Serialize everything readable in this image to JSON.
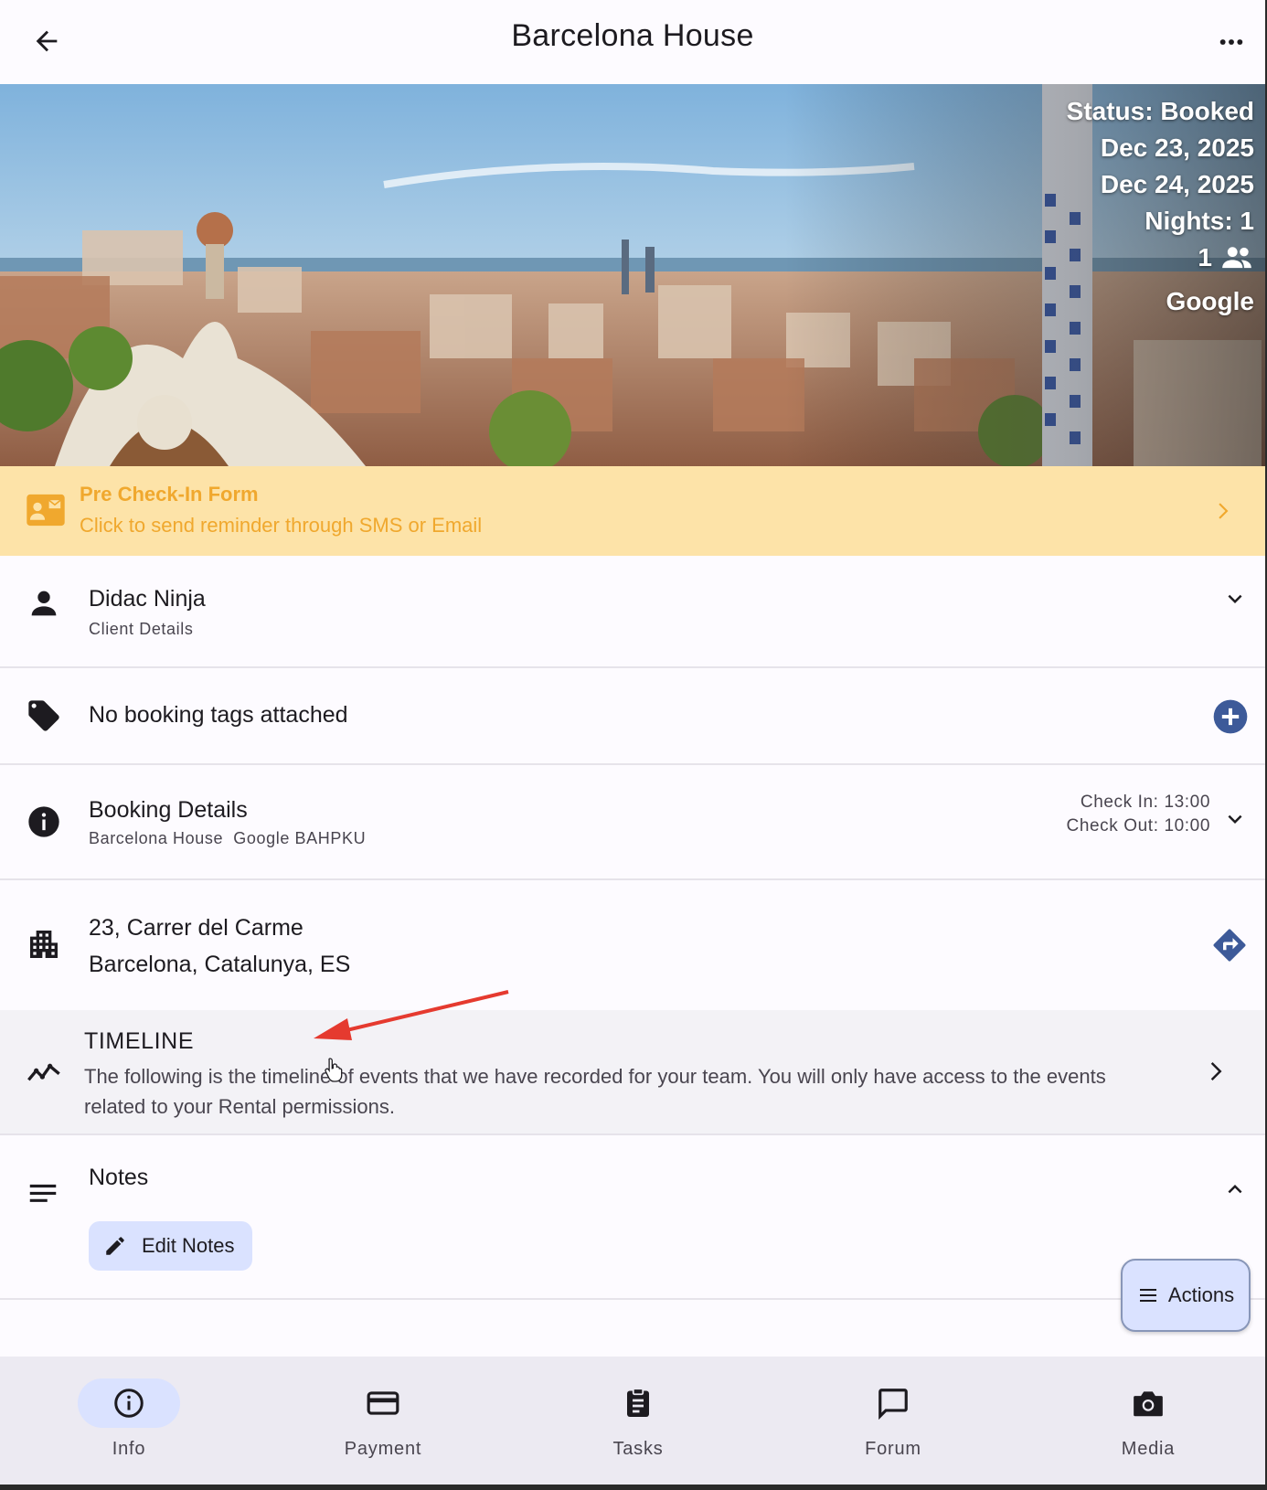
{
  "header": {
    "title": "Barcelona House",
    "back_icon": "arrow-back-icon",
    "more_icon": "more-horiz-icon"
  },
  "hero": {
    "status": "Status: Booked",
    "check_in_date": "Dec 23, 2025",
    "check_out_date": "Dec 24, 2025",
    "nights": "Nights: 1",
    "guests": "1",
    "source": "Google"
  },
  "banner": {
    "title": "Pre Check-In Form",
    "subtitle": "Click to send reminder through SMS or Email",
    "color": "#f0a82e",
    "background": "#fde3a8"
  },
  "client": {
    "name": "Didac Ninja",
    "label": "Client Details"
  },
  "tags": {
    "text": "No booking tags attached"
  },
  "booking": {
    "title": "Booking Details",
    "property": "Barcelona House",
    "source_code": "Google BAHPKU",
    "check_in": "Check In: 13:00",
    "check_out": "Check Out: 10:00"
  },
  "address": {
    "line1": "23, Carrer del Carme",
    "line2": "Barcelona, Catalunya, ES"
  },
  "timeline": {
    "title": "TIMELINE",
    "description": "The following is the timeline of events that we have recorded for your team. You will only have access to the events related to your Rental permissions."
  },
  "notes": {
    "title": "Notes",
    "edit_label": "Edit Notes"
  },
  "actions": {
    "label": "Actions"
  },
  "nav": {
    "items": [
      {
        "label": "Info",
        "icon": "info-icon",
        "active": true
      },
      {
        "label": "Payment",
        "icon": "credit-card-icon",
        "active": false
      },
      {
        "label": "Tasks",
        "icon": "clipboard-icon",
        "active": false
      },
      {
        "label": "Forum",
        "icon": "chat-bubble-icon",
        "active": false
      },
      {
        "label": "Media",
        "icon": "camera-icon",
        "active": false
      }
    ]
  },
  "colors": {
    "accent": "#3d5a99",
    "nav_active": "#dae2ff",
    "annotation_arrow": "#e53a2f"
  }
}
